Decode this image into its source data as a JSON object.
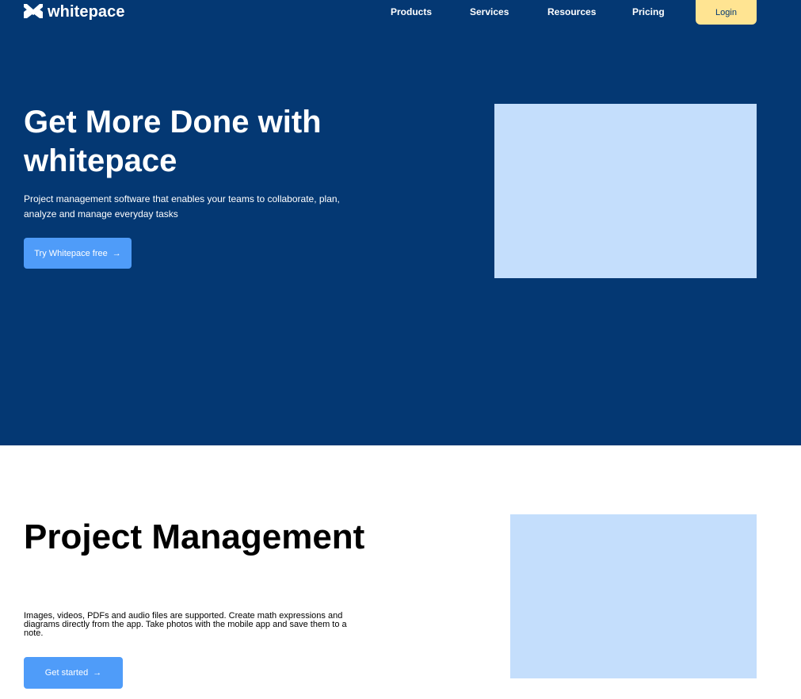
{
  "header": {
    "logo_text": "whitepace",
    "nav": [
      "Products",
      "Services",
      "Resources",
      "Pricing"
    ],
    "login_label": "Login"
  },
  "hero": {
    "title": "Get More Done with whitepace",
    "subtitle": "Project management software that enables your teams to collaborate, plan, analyze and manage everyday tasks",
    "cta_label": "Try Whitepace free",
    "cta_arrow": "→"
  },
  "section2": {
    "title": "Project Management",
    "text": "Images, videos, PDFs and audio files are supported. Create math expressions and diagrams directly from the app. Take photos with the mobile app and save them to a note.",
    "cta_label": "Get started",
    "cta_arrow": "→"
  },
  "colors": {
    "hero_bg": "#043873",
    "accent_blue": "#4f9cf9",
    "login_yellow": "#ffe492",
    "placeholder": "#c4defc"
  }
}
